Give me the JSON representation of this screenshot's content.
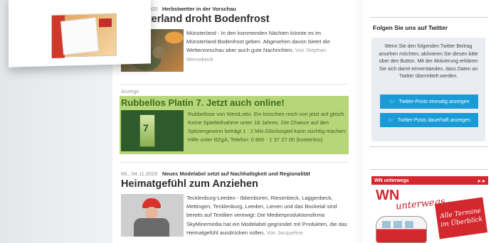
{
  "article1": {
    "date": "MI., 04.11.2020",
    "kicker": "Herbstwetter in der Vorschau",
    "headline": "Münsterland droht Bodenfrost",
    "teaser": "Münsterland - In den kommenden Nächten könnte es im Münsterland Bodenfrost geben. Abgesehen davon bietet die Wettervorschau aber auch gute Nachrichten.",
    "more": "Von Stephan Wersebeck"
  },
  "ad": {
    "label": "Anzeige",
    "headline": "Rubbellos Platin 7. Jetzt auch online!",
    "teaser": "Rubbellose von WestLotto. Ein bisschen reich von jetzt auf gleich. Keine Spielteilnahme unter 18 Jahren. Die Chance auf den Spitzengewinn beträgt 1 : 2 Mio.Glücksspiel kann süchtig machen: Hilfe unter BZgA; Telefon: 0 800 - 1 37 27 00 (kostenlos)",
    "ticket_text": "7"
  },
  "article2": {
    "date": "MI., 04.11.2020",
    "kicker": "Neues Modelabel setzt auf Nachhaltigkeit und Regionalität",
    "headline": "Heimatgefühl zum Anziehen",
    "teaser": "Tecklenburg-Leeden - Ibbenbüren, Riesenbeck, Laggenbeck, Mettingen, Tecklenburg, Leeden, Lienen und das Bocketal sind bereits auf Textilien verewigt: Die Medienproduktionsfirma SkyMinemedia hat ein Modelabel gegründet mit Produkten, die das Heimatgefühl ausdrücken sollen.",
    "more": "Von Jacqueline"
  },
  "sidebar": {
    "twitter_title": "Folgen Sie uns auf Twitter",
    "twitter_text": "Wenn Sie den folgenden Twitter Beitrag ansehen möchten, aktivieren Sie diesen bitte über den Button. Mit der Aktivierung erklären Sie sich damit einverstanden, dass Daten an Twitter übermittelt werden.",
    "btn_once": "Twitter-Posts einmalig anzeigen",
    "btn_always": "Twitter-Posts dauerhaft anzeigen",
    "wn_header": "WN unterwegs",
    "wn_logo": "WN",
    "wn_script": "unterwegs",
    "wn_tag": "Alle Termine im Überblick"
  },
  "colors": {
    "ad_highlight": "#b7d67a",
    "ad_title": "#3f6d1c",
    "twitter_blue": "#1a9ad6",
    "wn_red": "#d4282f"
  }
}
